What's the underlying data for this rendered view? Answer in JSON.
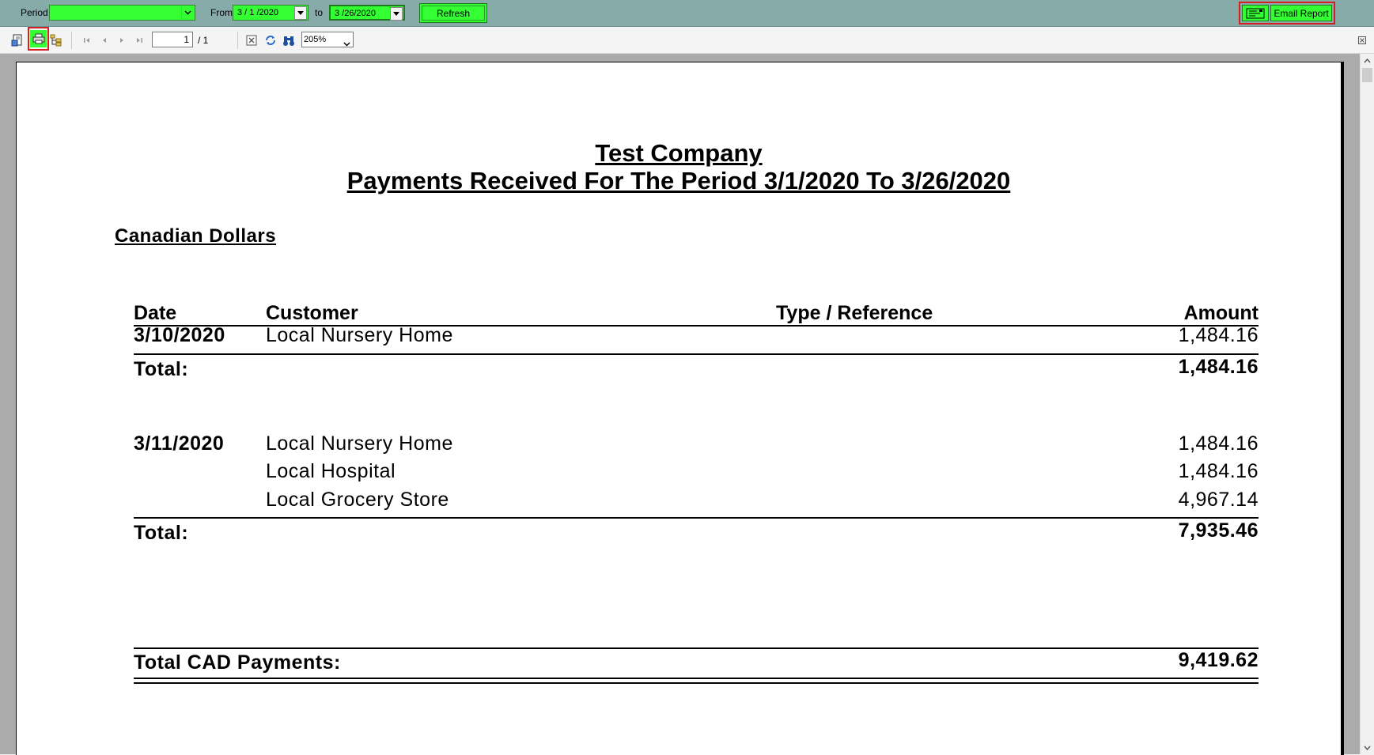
{
  "topbar": {
    "period_label": "Period",
    "period_value": "",
    "from_label": "From",
    "from_value": "3 / 1 /2020",
    "to_label": "to",
    "to_value": "3 /26/2020",
    "refresh_label": "Refresh",
    "email_label": "Email Report"
  },
  "toolbar": {
    "page_number": "1",
    "page_total": "/ 1",
    "zoom": "205%"
  },
  "report": {
    "company": "Test Company",
    "subtitle": "Payments Received  For The Period 3/1/2020 To 3/26/2020",
    "currency_heading": "Canadian Dollars",
    "columns": {
      "date": "Date",
      "customer": "Customer",
      "type_reference": "Type / Reference",
      "amount": "Amount"
    },
    "groups": [
      {
        "date": "3/10/2020",
        "rows": [
          {
            "customer": "Local Nursery Home",
            "amount": "1,484.16"
          }
        ],
        "total_label": "Total:",
        "total": "1,484.16"
      },
      {
        "date": "3/11/2020",
        "rows": [
          {
            "customer": "Local Nursery Home",
            "amount": "1,484.16"
          },
          {
            "customer": "Local Hospital",
            "amount": "1,484.16"
          },
          {
            "customer": "Local Grocery Store",
            "amount": "4,967.14"
          }
        ],
        "total_label": "Total:",
        "total": "7,935.46"
      }
    ],
    "grand_total_label": "Total CAD Payments:",
    "grand_total": "9,419.62"
  }
}
